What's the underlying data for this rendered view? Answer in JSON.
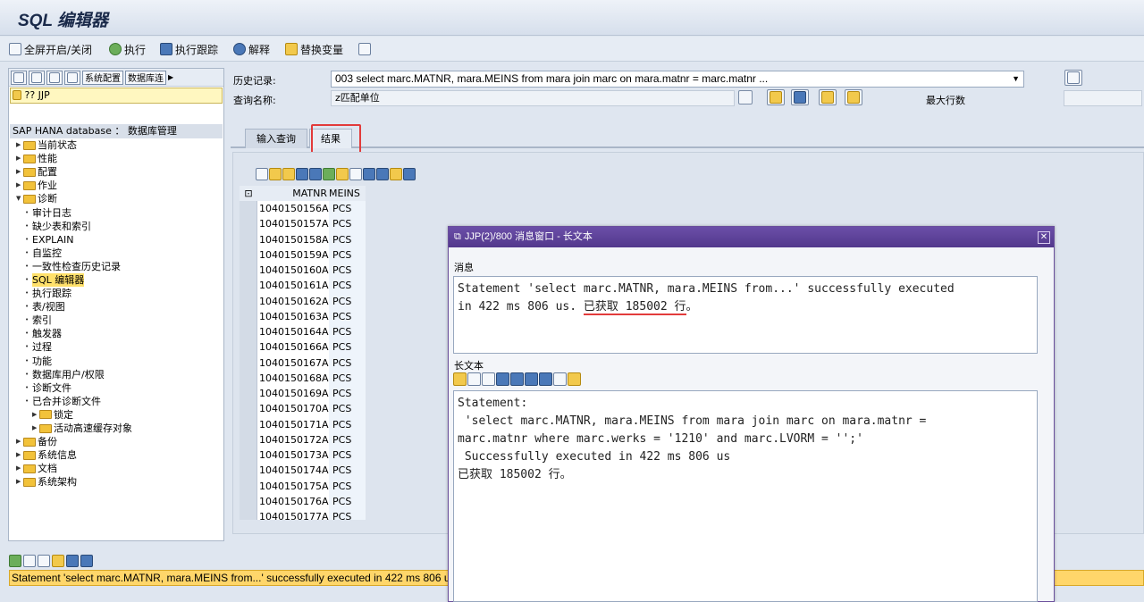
{
  "window": {
    "title": "SQL 编辑器"
  },
  "toolbar": {
    "fullscreen": "全屏开启/关闭",
    "execute": "执行",
    "exec_trace": "执行跟踪",
    "explain": "解释",
    "replace_var": "替换变量"
  },
  "left": {
    "btn_sysconfig": "系统配置",
    "btn_dbconn": "数据库连",
    "selected_system": "?? JJP",
    "tree_header": "SAP HANA database ： 数据库管理",
    "tree": [
      {
        "label": "当前状态",
        "level": 0,
        "folder": true
      },
      {
        "label": "性能",
        "level": 0,
        "folder": true
      },
      {
        "label": "配置",
        "level": 0,
        "folder": true
      },
      {
        "label": "作业",
        "level": 0,
        "folder": true
      },
      {
        "label": "诊断",
        "level": 0,
        "folder": true,
        "expanded": true
      },
      {
        "label": "审计日志",
        "level": 1
      },
      {
        "label": "缺少表和索引",
        "level": 1
      },
      {
        "label": "EXPLAIN",
        "level": 1
      },
      {
        "label": "自监控",
        "level": 1
      },
      {
        "label": "一致性检查历史记录",
        "level": 1
      },
      {
        "label": "SQL 编辑器",
        "level": 1,
        "selected": true
      },
      {
        "label": "执行跟踪",
        "level": 1
      },
      {
        "label": "表/视图",
        "level": 1
      },
      {
        "label": "索引",
        "level": 1
      },
      {
        "label": "触发器",
        "level": 1
      },
      {
        "label": "过程",
        "level": 1
      },
      {
        "label": "功能",
        "level": 1
      },
      {
        "label": "数据库用户/权限",
        "level": 1
      },
      {
        "label": "诊断文件",
        "level": 1
      },
      {
        "label": "已合并诊断文件",
        "level": 1
      },
      {
        "label": "锁定",
        "level": 1,
        "folder": true
      },
      {
        "label": "活动高速缓存对象",
        "level": 1,
        "folder": true
      },
      {
        "label": "备份",
        "level": 0,
        "folder": true
      },
      {
        "label": "系统信息",
        "level": 0,
        "folder": true
      },
      {
        "label": "文档",
        "level": 0,
        "folder": true
      },
      {
        "label": "系统架构",
        "level": 0,
        "folder": true
      }
    ]
  },
  "header": {
    "history_label": "历史记录:",
    "history_value": "003 select marc.MATNR, mara.MEINS from mara join marc on mara.matnr = marc.matnr ...",
    "query_name_label": "查询名称:",
    "query_name_value": "z匹配单位",
    "max_rows_label": "最大行数"
  },
  "tabs": [
    {
      "label": "输入查询",
      "active": false
    },
    {
      "label": "结果",
      "active": true
    }
  ],
  "grid": {
    "columns": [
      "MATNR",
      "MEINS"
    ],
    "rows": [
      [
        "1040150156A",
        "PCS"
      ],
      [
        "1040150157A",
        "PCS"
      ],
      [
        "1040150158A",
        "PCS"
      ],
      [
        "1040150159A",
        "PCS"
      ],
      [
        "1040150160A",
        "PCS"
      ],
      [
        "1040150161A",
        "PCS"
      ],
      [
        "1040150162A",
        "PCS"
      ],
      [
        "1040150163A",
        "PCS"
      ],
      [
        "1040150164A",
        "PCS"
      ],
      [
        "1040150166A",
        "PCS"
      ],
      [
        "1040150167A",
        "PCS"
      ],
      [
        "1040150168A",
        "PCS"
      ],
      [
        "1040150169A",
        "PCS"
      ],
      [
        "1040150170A",
        "PCS"
      ],
      [
        "1040150171A",
        "PCS"
      ],
      [
        "1040150172A",
        "PCS"
      ],
      [
        "1040150173A",
        "PCS"
      ],
      [
        "1040150174A",
        "PCS"
      ],
      [
        "1040150175A",
        "PCS"
      ],
      [
        "1040150176A",
        "PCS"
      ],
      [
        "1040150177A",
        "PCS"
      ]
    ]
  },
  "dialog": {
    "title": "JJP(2)/800 消息窗口 - 长文本",
    "message_label": "消息",
    "message_line1": "Statement 'select marc.MATNR, mara.MEINS from...' successfully executed",
    "message_line2_prefix": "in 422 ms 806 us. ",
    "message_line2_highlight": "已获取 185002 行",
    "message_line2_suffix": "。",
    "longtext_label": "长文本",
    "longtext": "Statement:\n 'select marc.MATNR, mara.MEINS from mara join marc on mara.matnr =\nmarc.matnr where marc.werks = '1210' and marc.LVORM = '';'\n Successfully executed in 422 ms 806 us\n已获取 185002 行。"
  },
  "status": {
    "message": "Statement 'select marc.MATNR, mara.MEINS from...' successfully executed in 422 ms 806 us. 已获取 185002 行。"
  }
}
